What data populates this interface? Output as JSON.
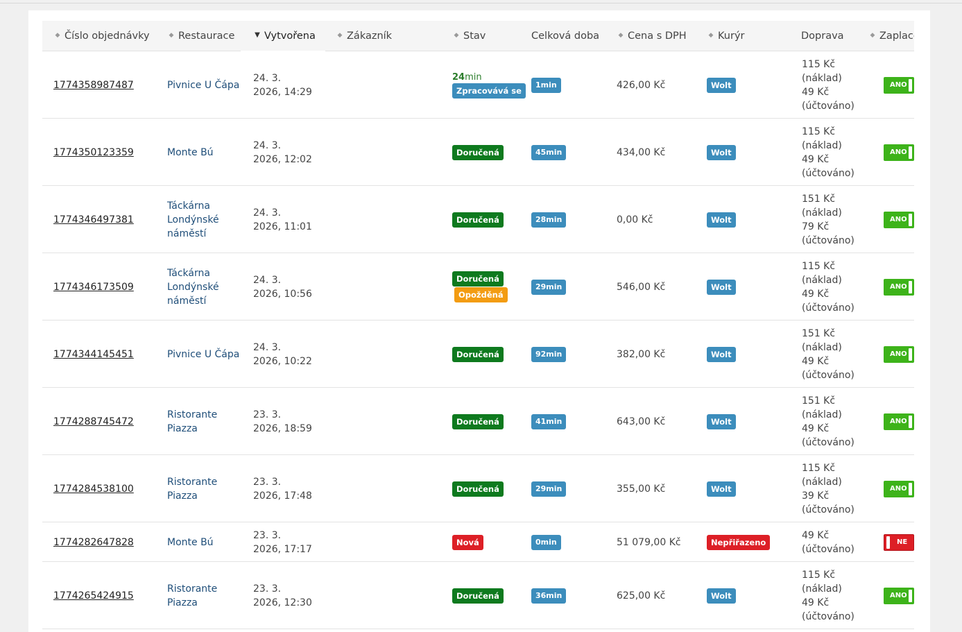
{
  "columns": {
    "order": "Číslo objednávky",
    "restaurant": "Restaurace",
    "created": "Vytvořena",
    "customer": "Zákazník",
    "state": "Stav",
    "duration": "Celková doba",
    "price": "Cena s DPH",
    "courier": "Kurýr",
    "transport": "Doprava",
    "paid": "Zaplace"
  },
  "rows": [
    {
      "order": "1774358987487",
      "restaurant": [
        "Pivnice U Čápa"
      ],
      "date": "24. 3.",
      "time": "2026, 14:29",
      "timer_value": "24",
      "timer_unit": "min",
      "statuses": [
        {
          "label": "Zpracovává se",
          "color": "#3c8dbc"
        }
      ],
      "duration": "1min",
      "price": "426,00 Kč",
      "courier": "Wolt",
      "courier_color": "#3c8dbc",
      "transport": [
        "115 Kč",
        "(náklad)",
        "49 Kč",
        "(účtováno)"
      ],
      "paid": "ANO",
      "paid_on": true
    },
    {
      "order": "1774350123359",
      "restaurant": [
        "Monte Bú"
      ],
      "date": "24. 3.",
      "time": "2026, 12:02",
      "statuses": [
        {
          "label": "Doručená",
          "color": "#0e7a1e"
        }
      ],
      "duration": "45min",
      "price": "434,00 Kč",
      "courier": "Wolt",
      "courier_color": "#3c8dbc",
      "transport": [
        "115 Kč",
        "(náklad)",
        "49 Kč",
        "(účtováno)"
      ],
      "paid": "ANO",
      "paid_on": true
    },
    {
      "order": "1774346497381",
      "restaurant": [
        "Táckárna",
        "Londýnské",
        "náměstí"
      ],
      "date": "24. 3.",
      "time": "2026, 11:01",
      "statuses": [
        {
          "label": "Doručená",
          "color": "#0e7a1e"
        }
      ],
      "duration": "28min",
      "price": "0,00 Kč",
      "courier": "Wolt",
      "courier_color": "#3c8dbc",
      "transport": [
        "151 Kč",
        "(náklad)",
        "79 Kč",
        "(účtováno)"
      ],
      "paid": "ANO",
      "paid_on": true
    },
    {
      "order": "1774346173509",
      "restaurant": [
        "Táckárna",
        "Londýnské",
        "náměstí"
      ],
      "date": "24. 3.",
      "time": "2026, 10:56",
      "statuses": [
        {
          "label": "Doručená",
          "color": "#0e7a1e"
        },
        {
          "label": "Opožděná",
          "color": "#f39c12"
        }
      ],
      "duration": "29min",
      "price": "546,00 Kč",
      "courier": "Wolt",
      "courier_color": "#3c8dbc",
      "transport": [
        "115 Kč",
        "(náklad)",
        "49 Kč",
        "(účtováno)"
      ],
      "paid": "ANO",
      "paid_on": true
    },
    {
      "order": "1774344145451",
      "restaurant": [
        "Pivnice U Čápa"
      ],
      "date": "24. 3.",
      "time": "2026, 10:22",
      "statuses": [
        {
          "label": "Doručená",
          "color": "#0e7a1e"
        }
      ],
      "duration": "92min",
      "price": "382,00 Kč",
      "courier": "Wolt",
      "courier_color": "#3c8dbc",
      "transport": [
        "151 Kč",
        "(náklad)",
        "49 Kč",
        "(účtováno)"
      ],
      "paid": "ANO",
      "paid_on": true
    },
    {
      "order": "1774288745472",
      "restaurant": [
        "Ristorante",
        "Piazza"
      ],
      "date": "23. 3.",
      "time": "2026, 18:59",
      "statuses": [
        {
          "label": "Doručená",
          "color": "#0e7a1e"
        }
      ],
      "duration": "41min",
      "price": "643,00 Kč",
      "courier": "Wolt",
      "courier_color": "#3c8dbc",
      "transport": [
        "151 Kč",
        "(náklad)",
        "49 Kč",
        "(účtováno)"
      ],
      "paid": "ANO",
      "paid_on": true
    },
    {
      "order": "1774284538100",
      "restaurant": [
        "Ristorante",
        "Piazza"
      ],
      "date": "23. 3.",
      "time": "2026, 17:48",
      "statuses": [
        {
          "label": "Doručená",
          "color": "#0e7a1e"
        }
      ],
      "duration": "29min",
      "price": "355,00 Kč",
      "courier": "Wolt",
      "courier_color": "#3c8dbc",
      "transport": [
        "115 Kč",
        "(náklad)",
        "39 Kč",
        "(účtováno)"
      ],
      "paid": "ANO",
      "paid_on": true
    },
    {
      "order": "1774282647828",
      "restaurant": [
        "Monte Bú"
      ],
      "date": "23. 3.",
      "time": "2026, 17:17",
      "statuses": [
        {
          "label": "Nová",
          "color": "#dd1f26"
        }
      ],
      "duration": "0min",
      "price": "51 079,00 Kč",
      "courier": "Nepřiřazeno",
      "courier_color": "#dd1f26",
      "transport": [
        "49 Kč",
        "(účtováno)"
      ],
      "paid": "NE",
      "paid_on": false
    },
    {
      "order": "1774265424915",
      "restaurant": [
        "Ristorante",
        "Piazza"
      ],
      "date": "23. 3.",
      "time": "2026, 12:30",
      "statuses": [
        {
          "label": "Doručená",
          "color": "#0e7a1e"
        }
      ],
      "duration": "36min",
      "price": "625,00 Kč",
      "courier": "Wolt",
      "courier_color": "#3c8dbc",
      "transport": [
        "115 Kč",
        "(náklad)",
        "49 Kč",
        "(účtováno)"
      ],
      "paid": "ANO",
      "paid_on": true
    }
  ]
}
